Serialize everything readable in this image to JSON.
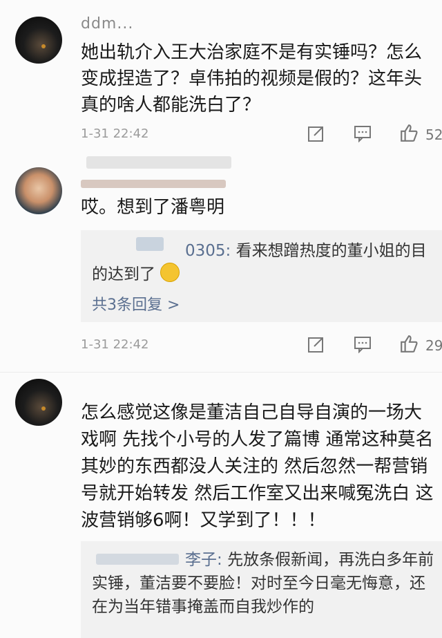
{
  "comments": [
    {
      "username": "ddm...",
      "text": "她出轨介入王大治家庭不是有实锤吗？怎么变成捏造了？卓伟拍的视频是假的？这年头真的啥人都能洗白了？",
      "time": "1-31 22:42",
      "likes": "52"
    },
    {
      "text": "哎。想到了潘粤明",
      "reply": {
        "name": "0305:",
        "text": "看来想蹭热度的董小姐的目的达到了",
        "more": "共3条回复 >"
      },
      "time": "1-31 22:42",
      "likes": "29"
    },
    {
      "text": "怎么感觉这像是董洁自己自导自演的一场大戏啊 先找个小号的人发了篇博 通常这种莫名其妙的东西都没人关注的 然后忽然一帮营销号就开始转发 然后工作室又出来喊冤洗白 这波营销够6啊！又学到了！！！",
      "reply": {
        "name": "李子:",
        "text": "先放条假新闻，再洗白多年前实锤，董洁要不要脸！对时至今日毫无悔意，还在为当年错事掩盖而自我炒作的"
      }
    }
  ],
  "icons": {
    "share": "share-icon",
    "comment": "comment-icon",
    "like": "thumbs-up-icon"
  }
}
